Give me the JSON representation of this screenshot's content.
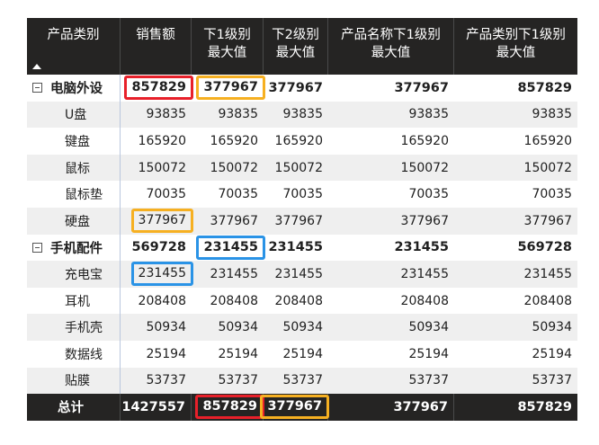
{
  "headers": {
    "col0": "产品类别",
    "col1": "销售额",
    "col2": [
      "下1级别",
      "最大值"
    ],
    "col3": [
      "下2级别",
      "最大值"
    ],
    "col4": [
      "产品名称下1级别",
      "最大值"
    ],
    "col5": [
      "产品类别下1级别",
      "最大值"
    ]
  },
  "groups": [
    {
      "name": "电脑外设",
      "values": [
        "857829",
        "377967",
        "377967",
        "377967",
        "857829"
      ],
      "items": [
        {
          "name": "U盘",
          "values": [
            "93835",
            "93835",
            "93835",
            "93835",
            "93835"
          ]
        },
        {
          "name": "键盘",
          "values": [
            "165920",
            "165920",
            "165920",
            "165920",
            "165920"
          ]
        },
        {
          "name": "鼠标",
          "values": [
            "150072",
            "150072",
            "150072",
            "150072",
            "150072"
          ]
        },
        {
          "name": "鼠标垫",
          "values": [
            "70035",
            "70035",
            "70035",
            "70035",
            "70035"
          ]
        },
        {
          "name": "硬盘",
          "values": [
            "377967",
            "377967",
            "377967",
            "377967",
            "377967"
          ]
        }
      ]
    },
    {
      "name": "手机配件",
      "values": [
        "569728",
        "231455",
        "231455",
        "231455",
        "569728"
      ],
      "items": [
        {
          "name": "充电宝",
          "values": [
            "231455",
            "231455",
            "231455",
            "231455",
            "231455"
          ]
        },
        {
          "name": "耳机",
          "values": [
            "208408",
            "208408",
            "208408",
            "208408",
            "208408"
          ]
        },
        {
          "name": "手机壳",
          "values": [
            "50934",
            "50934",
            "50934",
            "50934",
            "50934"
          ]
        },
        {
          "name": "数据线",
          "values": [
            "25194",
            "25194",
            "25194",
            "25194",
            "25194"
          ]
        },
        {
          "name": "贴膜",
          "values": [
            "53737",
            "53737",
            "53737",
            "53737",
            "53737"
          ]
        }
      ]
    }
  ],
  "total": {
    "label": "总计",
    "values": [
      "1427557",
      "857829",
      "377967",
      "377967",
      "857829"
    ]
  },
  "colors": {
    "header_bg": "#252423",
    "highlight_red": "#e8202a",
    "highlight_orange": "#f6b021",
    "highlight_blue": "#2a93e6"
  }
}
